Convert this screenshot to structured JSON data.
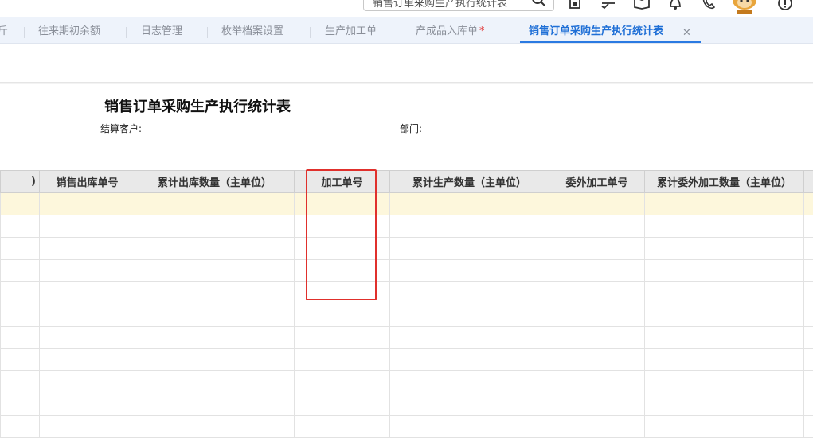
{
  "search": {
    "value": "销售订单采购生产执行统计表"
  },
  "tabs": [
    {
      "label": "斤"
    },
    {
      "label": "往来期初余额"
    },
    {
      "label": "日志管理"
    },
    {
      "label": "枚举档案设置"
    },
    {
      "label": "生产加工单"
    },
    {
      "label": "产成品入库单",
      "mark": "*"
    },
    {
      "label": "销售订单采购生产执行统计表",
      "active": true
    }
  ],
  "tab_close": "✕",
  "report": {
    "title": "销售订单采购生产执行统计表",
    "customer_label": "结算客户:",
    "dept_label": "部门:"
  },
  "table": {
    "columns": [
      ")",
      "销售出库单号",
      "累计出库数量（主单位）",
      "加工单号",
      "累计生产数量（主单位）",
      "委外加工单号",
      "累计委外加工数量（主单位）",
      ""
    ],
    "row_count": 11,
    "highlighted_row": 0
  },
  "colors": {
    "accent": "#2a7ae2",
    "highlight_box": "#e0302c",
    "row_highlight": "#fdf7dc"
  },
  "icons": [
    "search-icon",
    "home-icon",
    "task-icon",
    "book-icon",
    "bell-icon",
    "phone-icon",
    "mascot-icon",
    "help-icon"
  ]
}
